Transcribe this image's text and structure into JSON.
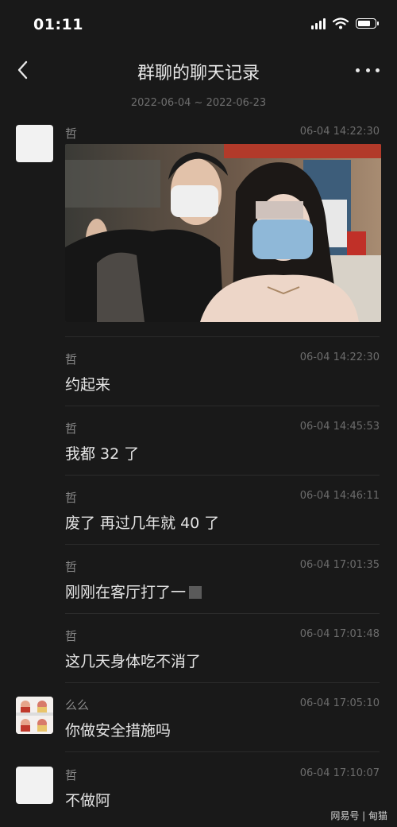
{
  "status_bar": {
    "time": "01:11"
  },
  "nav": {
    "title": "群聊的聊天记录"
  },
  "date_range": "2022-06-04 ~ 2022-06-23",
  "messages": [
    {
      "sender": "哲",
      "timestamp": "06-04 14:22:30",
      "type": "image"
    },
    {
      "sender": "哲",
      "timestamp": "06-04 14:22:30",
      "text": "约起来"
    },
    {
      "sender": "哲",
      "timestamp": "06-04 14:45:53",
      "text": "我都 32 了"
    },
    {
      "sender": "哲",
      "timestamp": "06-04 14:46:11",
      "text": "废了 再过几年就 40 了"
    },
    {
      "sender": "哲",
      "timestamp": "06-04 17:01:35",
      "text": "刚刚在客厅打了一"
    },
    {
      "sender": "哲",
      "timestamp": "06-04 17:01:48",
      "text": "这几天身体吃不消了"
    },
    {
      "sender": "么么",
      "timestamp": "06-04 17:05:10",
      "text": "你做安全措施吗"
    },
    {
      "sender": "哲",
      "timestamp": "06-04 17:10:07",
      "text": "不做阿"
    }
  ],
  "watermark": "网易号 | 甸猫"
}
